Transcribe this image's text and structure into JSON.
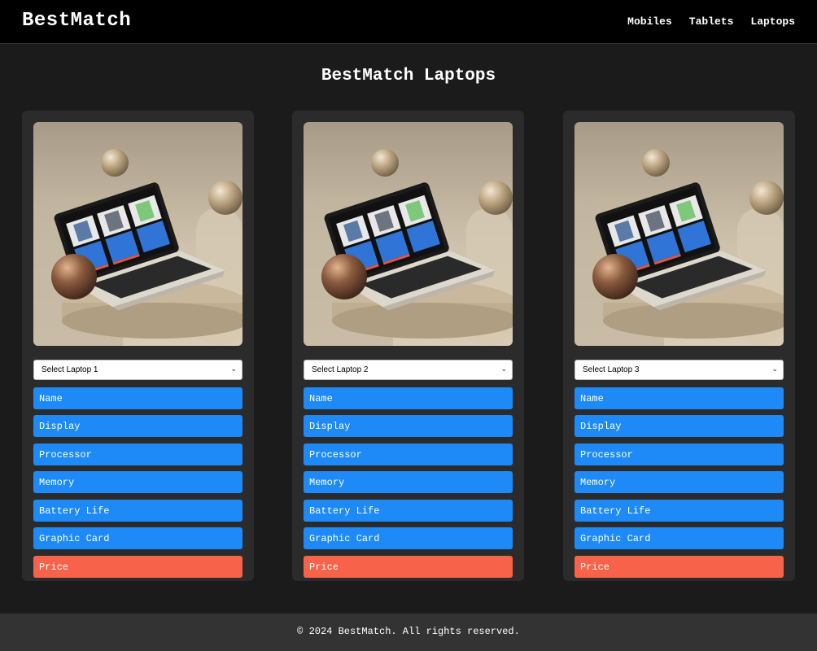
{
  "header": {
    "brand": "BestMatch",
    "nav": [
      "Mobiles",
      "Tablets",
      "Laptops"
    ]
  },
  "page": {
    "title": "BestMatch Laptops"
  },
  "cards": [
    {
      "select_label": "Select Laptop 1"
    },
    {
      "select_label": "Select Laptop 2"
    },
    {
      "select_label": "Select Laptop 3"
    }
  ],
  "specs": [
    "Name",
    "Display",
    "Processor",
    "Memory",
    "Battery Life",
    "Graphic Card",
    "Price"
  ],
  "footer": {
    "text": "© 2024 BestMatch. All rights reserved."
  },
  "colors": {
    "spec_field": "#1e8af7",
    "price_field": "#f7634a",
    "card_background": "#2b2b2b",
    "page_background": "#1b1b1b"
  },
  "icons": {
    "select": "chevron-down-icon"
  }
}
